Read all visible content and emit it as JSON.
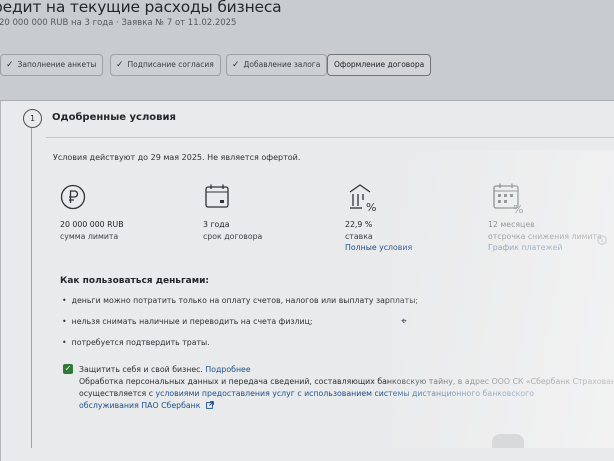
{
  "header": {
    "title": "редит на текущие расходы бизнеса",
    "subtitle": "20 000 000 RUB на 3 года · Заявка № 7 от 11.02.2025"
  },
  "steps": [
    {
      "label": "Заполнение анкеты",
      "done": true
    },
    {
      "label": "Подписание согласия",
      "done": true
    },
    {
      "label": "Добавление залога",
      "done": true
    },
    {
      "label": "Оформление договора",
      "done": false
    }
  ],
  "section": {
    "number": "1",
    "title": "Одобренные условия",
    "validity": "Условия действуют до 29 мая 2025. Не является офертой."
  },
  "metrics": [
    {
      "icon": "ruble-circle-icon",
      "value": "20 000 000 RUB",
      "label": "сумма лимита",
      "link": ""
    },
    {
      "icon": "calendar-icon",
      "value": "3 года",
      "label": "срок договора",
      "link": ""
    },
    {
      "icon": "bank-percent-icon",
      "value": "22,9 %",
      "label": "ставка",
      "link": "Полные условия"
    },
    {
      "icon": "calendar-percent-icon",
      "value": "12 месяцев",
      "label": "отсрочка снижения лимита",
      "link": "График платежей"
    }
  ],
  "howto": {
    "title": "Как пользоваться деньгами:",
    "bullets": [
      "деньги можно потратить только на оплату счетов, налогов или выплату зарплаты;",
      "нельзя снимать наличные и переводить на счета физлиц;",
      "потребуется подтвердить траты."
    ]
  },
  "insurance": {
    "checked": true,
    "label": "Защитить себя и свой бизнес.",
    "more_link": "Подробнее",
    "line2": "Обработка персональных данных и передача сведений, составляющих банковскую тайну, в адрес ООО СК «Сбербанк Страхование»",
    "line3_prefix": "осуществляется с ",
    "line3_link": "условиями предоставления услуг с использованием системы дистанционного банковского",
    "line4_link": "обслуживания ПАО Сбербанк"
  }
}
